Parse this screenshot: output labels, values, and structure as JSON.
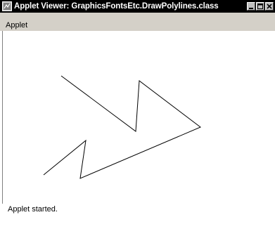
{
  "window": {
    "title": "Applet Viewer: GraphicsFontsEtc.DrawPolylines.class",
    "icon": "applet-viewer-icon",
    "controls": [
      "minimize-icon",
      "maximize-icon",
      "close-icon"
    ]
  },
  "menu": {
    "items": [
      {
        "label": "Applet"
      }
    ]
  },
  "status": {
    "text": "Applet started."
  },
  "colors": {
    "titlebar": "#000000",
    "menubar": "#d4d0c8",
    "canvas": "#ffffff",
    "polyline": "#000000"
  }
}
